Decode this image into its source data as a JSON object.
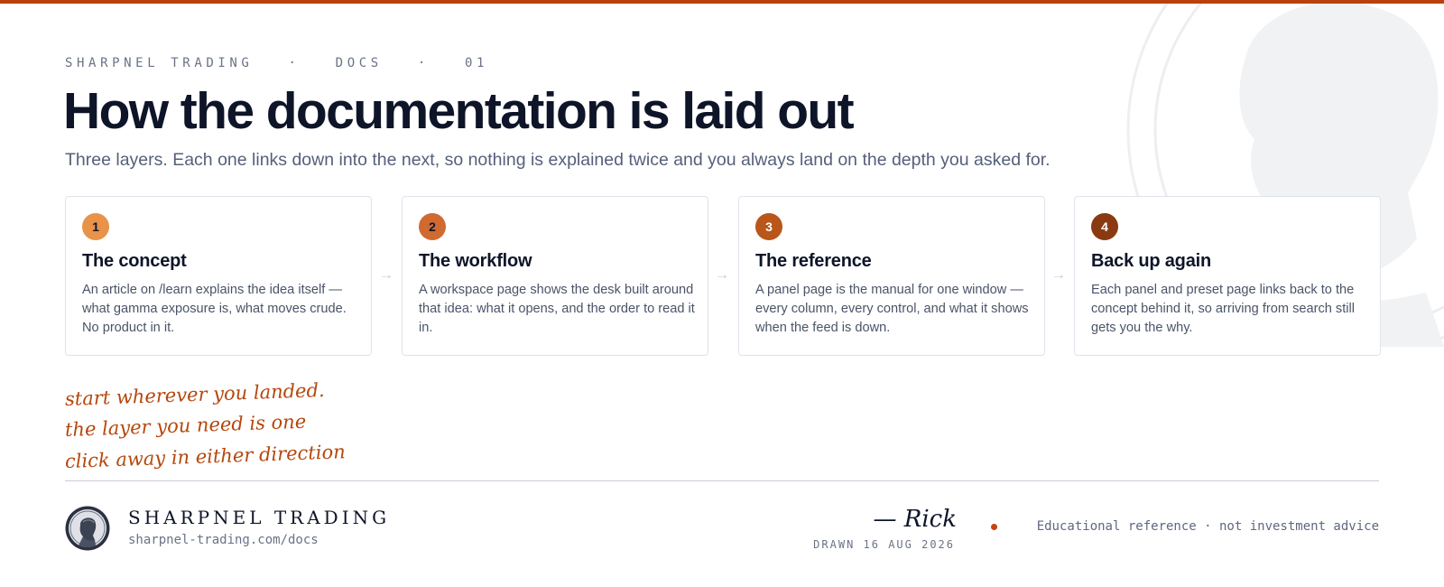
{
  "header": {
    "eyebrow": "SHARPNEL TRADING   ·   DOCS   ·   01",
    "title": "How the documentation is laid out",
    "subtitle": "Three layers. Each one links down into the next, so nothing is explained twice and you always land on the depth you asked for."
  },
  "steps": [
    {
      "number": "1",
      "title": "The concept",
      "body": "An article on /learn explains the idea itself — what gamma exposure is, what moves crude. No product in it.",
      "badge_color": "#e8924a"
    },
    {
      "number": "2",
      "title": "The workflow",
      "body": "A workspace page shows the desk built around that idea: what it opens, and the order to read it in.",
      "badge_color": "#d06a30"
    },
    {
      "number": "3",
      "title": "The reference",
      "body": "A panel page is the manual for one window — every column, every control, and what it shows when the feed is down.",
      "badge_color": "#b9561a"
    },
    {
      "number": "4",
      "title": "Back up again",
      "body": "Each panel and preset page links back to the concept behind it, so arriving from search still gets you the why.",
      "badge_color": "#8a3a10"
    }
  ],
  "arrow_glyph": "→",
  "note": {
    "lines": [
      "start wherever you landed.",
      "the layer you need is one",
      "click away in either direction"
    ]
  },
  "footer": {
    "brand": "SHARPNEL TRADING",
    "url": "sharpnel-trading.com/docs",
    "signature": "— Rick",
    "drawn": "DRAWN 16 AUG 2026",
    "disclaimer": "Educational reference · not investment advice"
  },
  "colors": {
    "accent": "#b8410f",
    "note": "#b5470c"
  }
}
